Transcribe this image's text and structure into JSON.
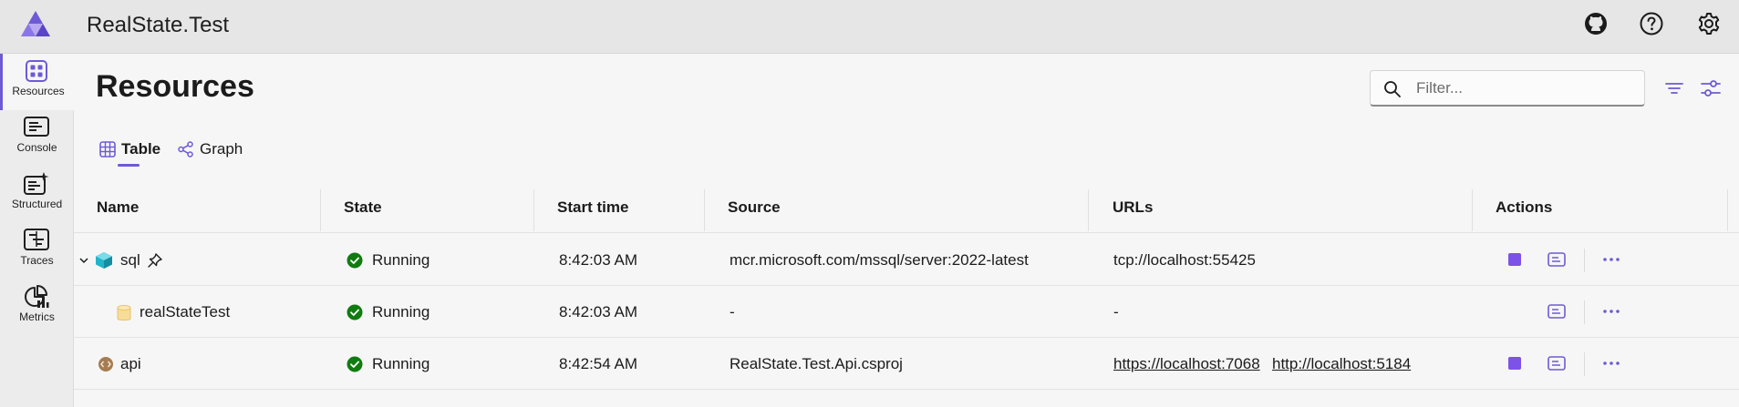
{
  "header": {
    "title": "RealState.Test",
    "icons": [
      "github-icon",
      "help-icon",
      "settings-icon"
    ]
  },
  "sidebar": {
    "items": [
      {
        "label": "Resources",
        "icon": "resources-icon",
        "active": true
      },
      {
        "label": "Console",
        "icon": "console-icon",
        "active": false
      },
      {
        "label": "Structured",
        "icon": "structured-logs-icon",
        "active": false
      },
      {
        "label": "Traces",
        "icon": "traces-icon",
        "active": false
      },
      {
        "label": "Metrics",
        "icon": "metrics-icon",
        "active": false
      }
    ]
  },
  "main": {
    "title": "Resources",
    "filter": {
      "placeholder": "Filter...",
      "value": ""
    },
    "tabs": [
      {
        "label": "Table",
        "icon": "table-icon",
        "active": true
      },
      {
        "label": "Graph",
        "icon": "graph-icon",
        "active": false
      }
    ]
  },
  "table": {
    "columns": [
      "Name",
      "State",
      "Start time",
      "Source",
      "URLs",
      "Actions"
    ],
    "rows": [
      {
        "name": "sql",
        "state": "Running",
        "start_time": "8:42:03 AM",
        "source": "mcr.microsoft.com/mssql/server:2022-latest",
        "urls": [
          "tcp://localhost:55425"
        ],
        "expanded": true,
        "pinned": true,
        "icon": "container-icon"
      },
      {
        "name": "realStateTest",
        "state": "Running",
        "start_time": "8:42:03 AM",
        "source": "-",
        "urls": [
          "-"
        ],
        "icon": "database-icon"
      },
      {
        "name": "api",
        "state": "Running",
        "start_time": "8:42:54 AM",
        "source": "RealState.Test.Api.csproj",
        "urls": [
          "https://localhost:7068",
          "http://localhost:5184"
        ],
        "icon": "project-icon"
      }
    ]
  },
  "colors": {
    "accent": "#6e5ad6",
    "running": "#107c10",
    "stop": "#7d52e8"
  }
}
